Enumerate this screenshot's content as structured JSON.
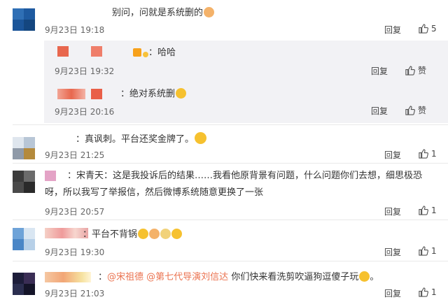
{
  "comments": [
    {
      "text": "别问，问就是系统删的",
      "date": "9月23日 19:18",
      "reply": "回复",
      "likes": "5"
    },
    {
      "text": "哈哈",
      "date": "9月23日 19:32",
      "reply": "回复",
      "likes": "赞"
    },
    {
      "text": "绝对系统删",
      "date": "9月23日 20:16",
      "reply": "回复",
      "likes": "赞"
    },
    {
      "text": "：真讽刺。平台还奖金牌了。",
      "date": "9月23日 21:25",
      "reply": "回复",
      "likes": "1"
    },
    {
      "line1": "：宋青天：这是我投诉后的结果……我看他原背景有问题，什么问题你们去想，细思极恐",
      "line2": "呀，所以我写了举报信，然后微博系统随意更换了一张",
      "date": "9月23日 20:57",
      "reply": "回复",
      "likes": "1"
    },
    {
      "text": "：平台不背锅",
      "date": "9月23日 19:30",
      "reply": "回复",
      "likes": "1"
    },
    {
      "mention1": "@宋祖德",
      "mention2": "@第七代导演刘信达",
      "text": " 你们快来看洗剪吹逼狗逗傻子玩",
      "date": "9月23日 21:03",
      "reply": "回复",
      "likes": "1"
    }
  ],
  "colors": {
    "background": "#ffffff",
    "reply_box": "#f2f2f5",
    "mention": "#eb7350",
    "date": "#666666"
  }
}
